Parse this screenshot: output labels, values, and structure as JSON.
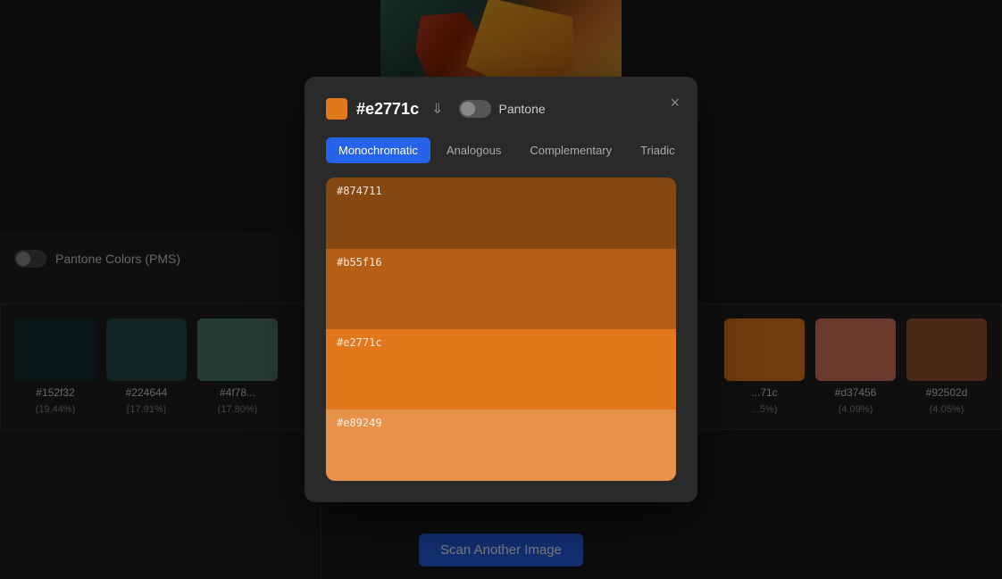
{
  "background": {
    "image_area": "leaves on dark teal background"
  },
  "left_panel": {
    "pantone_toggle_label": "Pantone Colors (PMS)",
    "swatches": [
      {
        "hex": "#152f32",
        "pct": "(19.44%)",
        "color": "#152f32"
      },
      {
        "hex": "#224644",
        "pct": "(17.91%)",
        "color": "#224644"
      },
      {
        "hex": "#4f78...",
        "pct": "(17.80%)",
        "color": "#4f7868"
      },
      {
        "hex": "..71c",
        "pct": "...5%)",
        "color": "#e2771c"
      },
      {
        "hex": "#d37456",
        "pct": "(4.09%)",
        "color": "#d37456"
      },
      {
        "hex": "#92502d",
        "pct": "(4.05%)",
        "color": "#92502d"
      }
    ]
  },
  "scan_button": {
    "label": "Scan Another Image"
  },
  "modal": {
    "color_hex": "#e2771c",
    "color_value": "#e2771c",
    "pantone_label": "Pantone",
    "close_label": "×",
    "tabs": [
      {
        "id": "monochromatic",
        "label": "Monochromatic",
        "active": true
      },
      {
        "id": "analogous",
        "label": "Analogous",
        "active": false
      },
      {
        "id": "complementary",
        "label": "Complementary",
        "active": false
      },
      {
        "id": "triadic",
        "label": "Triadic",
        "active": false
      }
    ],
    "palette": [
      {
        "hex": "#874711",
        "color": "#874711"
      },
      {
        "hex": "#b55f16",
        "color": "#b55f16"
      },
      {
        "hex": "#e2771c",
        "color": "#e2771c"
      },
      {
        "hex": "#e89249",
        "color": "#e89249"
      }
    ]
  }
}
